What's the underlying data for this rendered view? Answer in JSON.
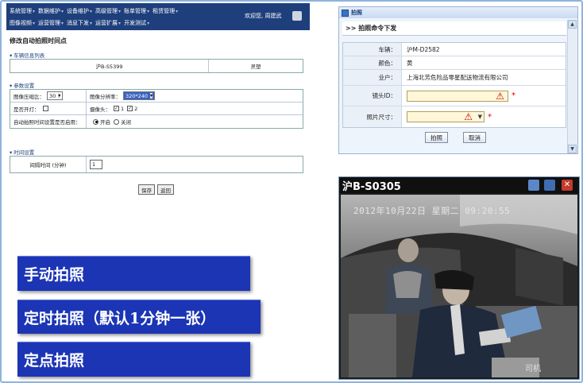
{
  "menu": {
    "row1": [
      "系统管理",
      "数据维护",
      "设备维护",
      "高级管理",
      "账单管理",
      "租赁管理"
    ],
    "row2": [
      "图像视频",
      "运营管理",
      "消息下发",
      "运营扩展",
      "开发测试"
    ],
    "welcome": "欢迎您, 周建武"
  },
  "page": {
    "title": "修改自动拍照时间点",
    "vehicle_section": "车辆信息列表",
    "vehicle_plate": "沪B-S5399",
    "vehicle_status": "灵塑",
    "param_section": "参数设置",
    "compress_label": "图像压缩比：",
    "compress_value": "30",
    "resolution_label": "图像分辨率：",
    "resolution_value": "320*240",
    "open_label": "是否开灯：",
    "camera_label": "摄像头：",
    "cam1": "1",
    "cam2": "2",
    "auto_label": "自动拍照时间设置是否启用：",
    "radio_on": "开启",
    "radio_off": "关闭",
    "time_section": "时间设置",
    "interval_label": "间隔时间 (分钟)",
    "interval_value": "1",
    "save_btn": "保存",
    "back_btn": "返回"
  },
  "features": [
    "手动拍照",
    "定时拍照（默认1分钟一张）",
    "定点拍照"
  ],
  "dialog": {
    "title": "拍照",
    "header": ">> 拍照命令下发",
    "vehicle_label": "车辆：",
    "vehicle_value": "沪M-D2582",
    "color_label": "颜色：",
    "color_value": "黄",
    "owner_label": "业户：",
    "owner_value": "上海北芳危险品零星配送物流有限公司",
    "lens_label": "镜头ID：",
    "size_label": "照片尺寸：",
    "ok_btn": "拍照",
    "cancel_btn": "取消"
  },
  "camera": {
    "title": "沪B-S0305",
    "timestamp": "2012年10月22日  星期二  09:20:55",
    "watermark": "司机"
  }
}
